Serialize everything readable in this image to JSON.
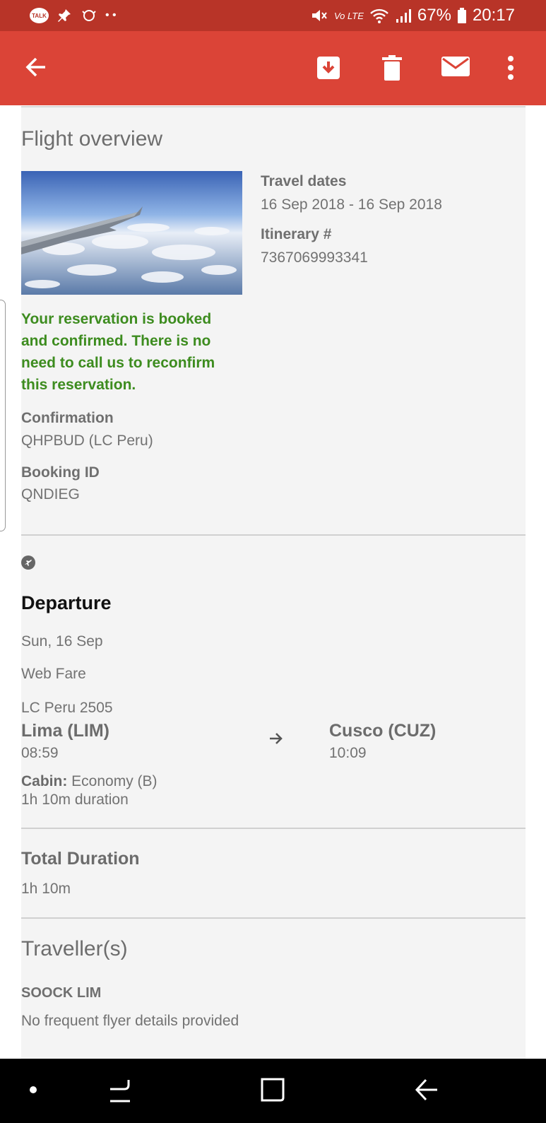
{
  "status_bar": {
    "battery": "67%",
    "time": "20:17",
    "talk": "TALK",
    "dots": "• •",
    "lte": "Vo LTE"
  },
  "overview": {
    "title": "Flight overview",
    "travel_dates_label": "Travel dates",
    "travel_dates": "16 Sep 2018 - 16 Sep 2018",
    "itinerary_label": "Itinerary #",
    "itinerary": "7367069993341",
    "confirmed_message": "Your reservation is booked and confirmed. There is no need to call us to reconfirm this reservation.",
    "confirmation_label": "Confirmation",
    "confirmation": "QHPBUD (LC Peru)",
    "booking_label": "Booking ID",
    "booking": "QNDIEG"
  },
  "departure": {
    "title": "Departure",
    "date": "Sun, 16 Sep",
    "fare": "Web Fare",
    "flight": "LC Peru 2505",
    "from_city": "Lima (LIM)",
    "from_time": "08:59",
    "to_city": "Cusco (CUZ)",
    "to_time": "10:09",
    "cabin_label": "Cabin:",
    "cabin": "Economy (B)",
    "duration": "1h 10m duration"
  },
  "total": {
    "label": "Total Duration",
    "value": "1h 10m"
  },
  "travellers": {
    "title": "Traveller(s)",
    "name": "SOOCK LIM",
    "ff": "No frequent flyer details provided"
  },
  "colors": {
    "status_bar": "#b83428",
    "app_bar": "#db4437",
    "confirm_green": "#3d8c1f"
  }
}
